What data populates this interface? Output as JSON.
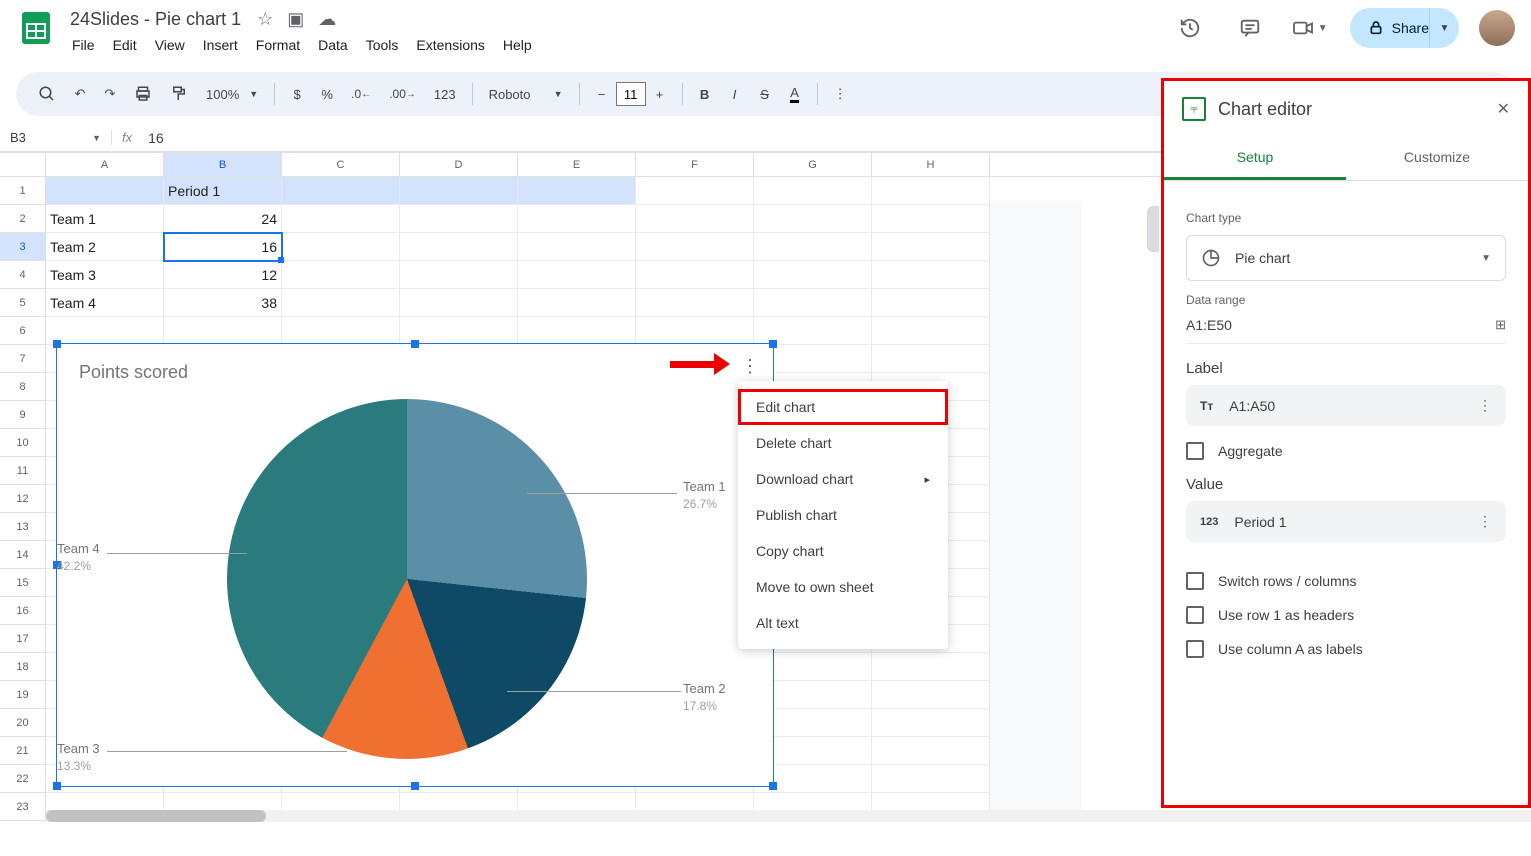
{
  "doc": {
    "title": "24Slides - Pie chart 1"
  },
  "menus": {
    "file": "File",
    "edit": "Edit",
    "view": "View",
    "insert": "Insert",
    "format": "Format",
    "data": "Data",
    "tools": "Tools",
    "extensions": "Extensions",
    "help": "Help"
  },
  "toolbar": {
    "zoom": "100%",
    "font": "Roboto",
    "fontsize": "11",
    "numfmt": "123"
  },
  "share": {
    "label": "Share"
  },
  "namebox": "B3",
  "formula": "16",
  "columns": [
    "A",
    "B",
    "C",
    "D",
    "E",
    "F",
    "G",
    "H"
  ],
  "sheet": {
    "r1": {
      "b": "Period 1"
    },
    "r2": {
      "a": "Team 1",
      "b": "24"
    },
    "r3": {
      "a": "Team 2",
      "b": "16"
    },
    "r4": {
      "a": "Team 3",
      "b": "12"
    },
    "r5": {
      "a": "Team 4",
      "b": "38"
    }
  },
  "chart_data": {
    "type": "pie",
    "title": "Points scored",
    "series": [
      {
        "name": "Team 1",
        "value": 24,
        "pct": "26.7%",
        "color": "#5b8fa8"
      },
      {
        "name": "Team 2",
        "value": 16,
        "pct": "17.8%",
        "color": "#0e4a66"
      },
      {
        "name": "Team 3",
        "value": 12,
        "pct": "13.3%",
        "color": "#ef7031"
      },
      {
        "name": "Team 4",
        "value": 38,
        "pct": "42.2%",
        "color": "#2a7b7e"
      }
    ]
  },
  "ctx": {
    "edit": "Edit chart",
    "delete": "Delete chart",
    "download": "Download chart",
    "publish": "Publish chart",
    "copy": "Copy chart",
    "move": "Move to own sheet",
    "alt": "Alt text"
  },
  "sidebar": {
    "title": "Chart editor",
    "tab_setup": "Setup",
    "tab_customize": "Customize",
    "chart_type_label": "Chart type",
    "chart_type_value": "Pie chart",
    "data_range_label": "Data range",
    "data_range_value": "A1:E50",
    "label_label": "Label",
    "label_value": "A1:A50",
    "aggregate": "Aggregate",
    "value_label": "Value",
    "value_value": "Period 1",
    "switch": "Switch rows / columns",
    "row1headers": "Use row 1 as headers",
    "colAlabels": "Use column A as labels"
  }
}
